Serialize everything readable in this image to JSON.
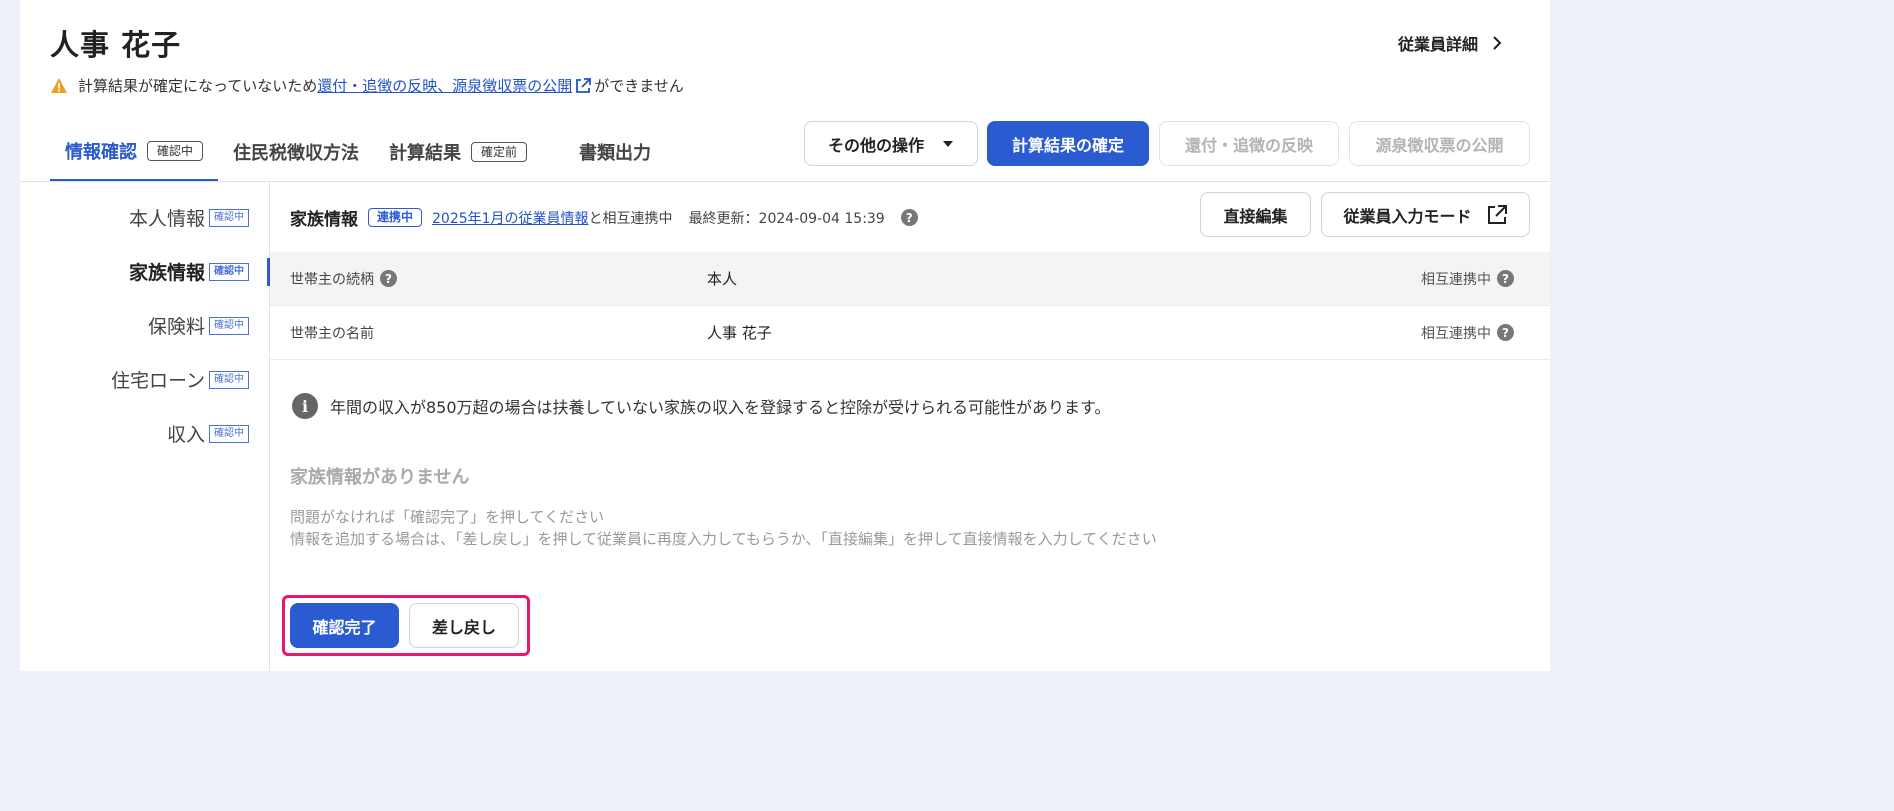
{
  "header": {
    "employee_name": "人事 花子",
    "detail_link": "従業員詳細",
    "warning_prefix": "計算結果が確定になっていないため",
    "warning_link": "還付・追徴の反映、源泉徴収票の公開",
    "warning_suffix": "ができません"
  },
  "tabs": [
    {
      "label": "情報確認",
      "tag": "確認中",
      "active": true
    },
    {
      "label": "住民税徴収方法",
      "tag": ""
    },
    {
      "label": "計算結果",
      "tag": "確定前"
    },
    {
      "label": "書類出力",
      "tag": ""
    }
  ],
  "actions": {
    "other_ops": "その他の操作",
    "confirm_calc": "計算結果の確定",
    "apply_refund": "還付・追徴の反映",
    "publish_slip": "源泉徴収票の公開"
  },
  "sidebar": {
    "items": [
      {
        "label": "本人情報",
        "tag": "確認中"
      },
      {
        "label": "家族情報",
        "tag": "確認中",
        "active": true
      },
      {
        "label": "保険料",
        "tag": "確認中"
      },
      {
        "label": "住宅ローン",
        "tag": "確認中"
      },
      {
        "label": "収入",
        "tag": "確認中"
      }
    ]
  },
  "section": {
    "title": "家族情報",
    "link_tag": "連携中",
    "link_text": "2025年1月の従業員情報",
    "link_suffix": "と相互連携中",
    "last_updated": "最終更新：2024-09-04 15:39",
    "direct_edit": "直接編集",
    "input_mode": "従業員入力モード"
  },
  "rows": [
    {
      "label": "世帯主の続柄",
      "value": "本人",
      "status": "相互連携中"
    },
    {
      "label": "世帯主の名前",
      "value": "人事 花子",
      "status": "相互連携中"
    }
  ],
  "info_message": "年間の収入が850万超の場合は扶養していない家族の収入を登録すると控除が受けられる可能性があります。",
  "empty": {
    "title": "家族情報がありません",
    "line1": "問題がなければ「確認完了」を押してください",
    "line2": "情報を追加する場合は、「差し戻し」を押して従業員に再度入力してもらうか、「直接編集」を押して直接情報を入力してください"
  },
  "footer": {
    "confirm": "確認完了",
    "return": "差し戻し"
  },
  "colors": {
    "accent": "#2b5bd1",
    "highlight": "#e8176b",
    "warning": "#f0a020"
  }
}
